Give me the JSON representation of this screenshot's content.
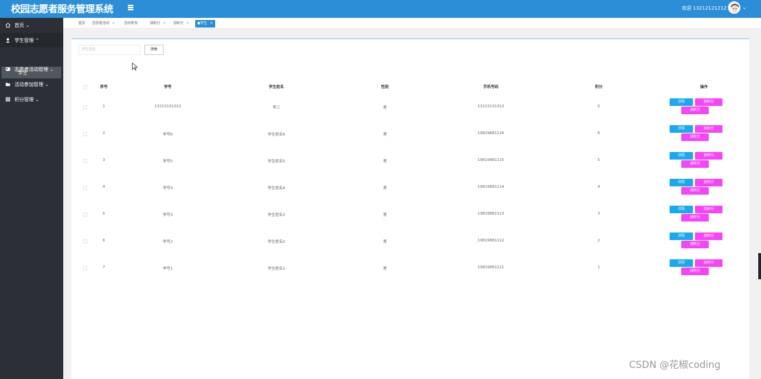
{
  "header": {
    "app_title": "校园志愿者服务管理系统",
    "welcome_text": "欢迎 13212121212"
  },
  "sidebar": {
    "items": [
      {
        "label": "首页",
        "icon": "home-icon"
      },
      {
        "label": "学生管理",
        "icon": "user-icon",
        "expanded": true
      },
      {
        "label": "志愿者活动管理",
        "icon": "card-icon"
      },
      {
        "label": "活动参加管理",
        "icon": "folder-icon"
      },
      {
        "label": "积分管理",
        "icon": "grid-icon"
      }
    ],
    "sub_item": "学生"
  },
  "tabs": [
    {
      "label": "首页",
      "closable": false
    },
    {
      "label": "志愿者活动",
      "closable": true
    },
    {
      "label": "活动参加",
      "closable": false
    },
    {
      "label": "减积分",
      "closable": true
    },
    {
      "label": "加积分",
      "closable": true
    },
    {
      "label": "●学生",
      "closable": true,
      "active": true
    }
  ],
  "search": {
    "placeholder": "学生姓名",
    "button_label": "搜索"
  },
  "table": {
    "headers": [
      "序号",
      "学号",
      "学生姓名",
      "性别",
      "手机号码",
      "积分",
      "操作"
    ],
    "rows": [
      {
        "seq": "1",
        "student_no": "13213131313",
        "name": "李三",
        "gender": "男",
        "phone": "13213131313",
        "points": "0"
      },
      {
        "seq": "2",
        "student_no": "学号6",
        "name": "学生姓名6",
        "gender": "男",
        "phone": "19819881116",
        "points": "6"
      },
      {
        "seq": "3",
        "student_no": "学号5",
        "name": "学生姓名5",
        "gender": "男",
        "phone": "19819881115",
        "points": "5"
      },
      {
        "seq": "4",
        "student_no": "学号4",
        "name": "学生姓名4",
        "gender": "男",
        "phone": "19819881114",
        "points": "4"
      },
      {
        "seq": "5",
        "student_no": "学号3",
        "name": "学生姓名3",
        "gender": "男",
        "phone": "19819881113",
        "points": "3"
      },
      {
        "seq": "6",
        "student_no": "学号2",
        "name": "学生姓名2",
        "gender": "男",
        "phone": "19819881112",
        "points": "2"
      },
      {
        "seq": "7",
        "student_no": "学号1",
        "name": "学生姓名1",
        "gender": "男",
        "phone": "19819881111",
        "points": "1"
      }
    ],
    "actions": {
      "detail": "详情",
      "add_points": "加积分",
      "sub_points": "减积分"
    }
  },
  "watermark": "CSDN @花椒coding",
  "colors": {
    "header_bg": "#2b8ed6",
    "sidebar_bg": "#2b3036",
    "detail_btn": "#1aa9ee",
    "points_btn": "#f446f6"
  }
}
